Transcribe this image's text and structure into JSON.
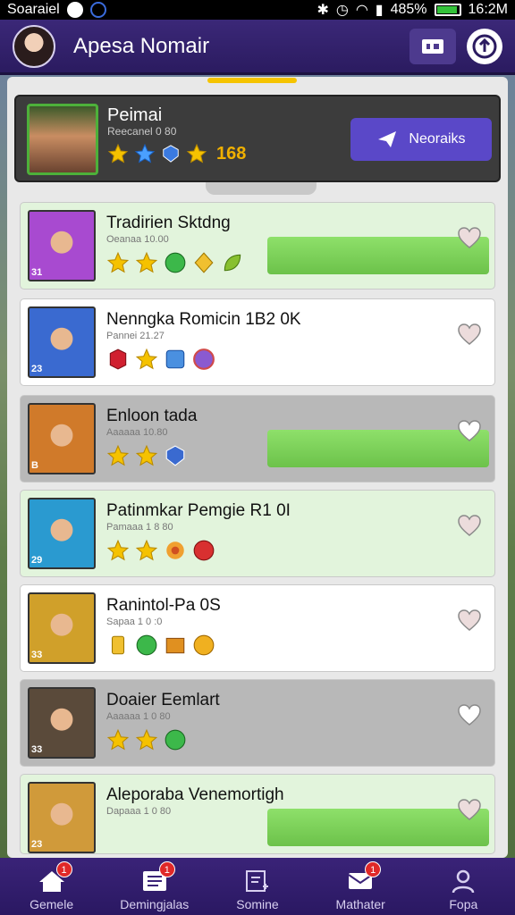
{
  "status_bar": {
    "carrier": "Soaraiel",
    "battery": "485%",
    "time": "16:2M"
  },
  "header": {
    "title": "Apesa Nomair"
  },
  "profile": {
    "name": "Peimai",
    "subtitle": "Reecanel 0 80",
    "score": "168",
    "messages_label": "Neoraiks"
  },
  "list": [
    {
      "title": "Tradirien Sktdng",
      "subtitle": "Oeanaa 10.00",
      "level": "31",
      "progress": 1.0,
      "variant": "green",
      "badges": [
        "star",
        "star",
        "gem-green",
        "gem-gold",
        "gem-leaf"
      ],
      "thumb_color": "#a84ad0"
    },
    {
      "title": "Nenngka Romicin 1B2 0K",
      "subtitle": "Pannei 21.27",
      "level": "23",
      "progress": 0,
      "variant": "white",
      "badges": [
        "gem-red",
        "star",
        "gem-blue",
        "gem-purple"
      ],
      "thumb_color": "#3a6ad0"
    },
    {
      "title": "Enloon tada",
      "subtitle": "Aaaaaa 10.80",
      "level": "B",
      "progress": 1.0,
      "variant": "gray",
      "badges": [
        "star",
        "star",
        "gem-shield"
      ],
      "thumb_color": "#d07a2a"
    },
    {
      "title": "Patinmkar Pemgie R1 0I",
      "subtitle": "Pamaaa 1 8 80",
      "level": "29",
      "progress": 0,
      "variant": "green",
      "badges": [
        "star",
        "star",
        "gem-flower",
        "gem-coin"
      ],
      "thumb_color": "#2a9ad0"
    },
    {
      "title": "Ranintol-Pa 0S",
      "subtitle": "Sapaa 1 0 :0",
      "level": "33",
      "progress": 0,
      "variant": "white",
      "badges": [
        "gem-bar",
        "gem-green",
        "gem-box",
        "gem-coin-gold"
      ],
      "thumb_color": "#d0a02a"
    },
    {
      "title": "Doaier Eemlart",
      "subtitle": "Aaaaaa 1 0 80",
      "level": "33",
      "progress": 0,
      "variant": "gray",
      "badges": [
        "star",
        "star",
        "gem-green"
      ],
      "thumb_color": "#5a4a3a"
    },
    {
      "title": "Aleporaba Venemortigh",
      "subtitle": "Dapaaa 1 0 80",
      "level": "23",
      "progress": 1.0,
      "variant": "green",
      "badges": [],
      "thumb_color": "#d09a3a"
    }
  ],
  "bottom_nav": [
    {
      "label": "Gemele",
      "badge": "1",
      "icon": "home-icon"
    },
    {
      "label": "Demingjalas",
      "badge": "1",
      "icon": "list-icon"
    },
    {
      "label": "Somine",
      "badge": "",
      "icon": "edit-icon"
    },
    {
      "label": "Mathater",
      "badge": "1",
      "icon": "mail-icon"
    },
    {
      "label": "Fopa",
      "badge": "",
      "icon": "person-icon"
    }
  ]
}
